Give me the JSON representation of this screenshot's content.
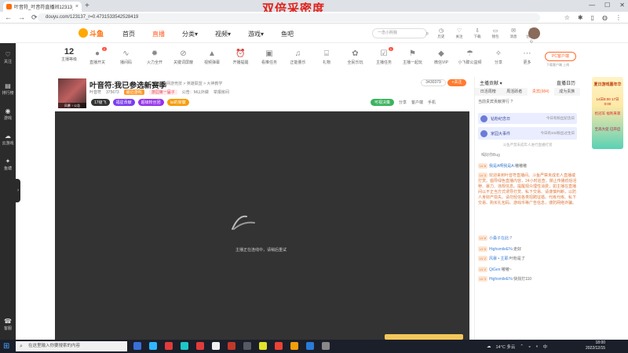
{
  "browser": {
    "tab_title": "叶音符_叶音符直播间12313_斗鱼",
    "tab_close": "×",
    "new_tab": "+",
    "overlay_text": "双倍采密度",
    "url": "douyu.com/123137_r=0.4731533542528419",
    "nav": {
      "back": "←",
      "forward": "→",
      "reload": "⟳"
    },
    "window_controls": {
      "minimize": "—",
      "maximize": "☐",
      "close": "✕"
    }
  },
  "header": {
    "logo_text": "斗鱼",
    "nav": [
      "首页",
      "直播",
      "分类▾",
      "视频▾",
      "游戏▾",
      "鱼吧"
    ],
    "active_nav": "直播",
    "search_placeholder": "一念小熙我",
    "icons": [
      {
        "name": "history",
        "label": "历史",
        "glyph": "◷"
      },
      {
        "name": "follow",
        "label": "关注",
        "glyph": "♡"
      },
      {
        "name": "download",
        "label": "下载",
        "glyph": "⇩"
      },
      {
        "name": "wallet",
        "label": "钱包",
        "glyph": "▭"
      },
      {
        "name": "message",
        "label": "消息",
        "glyph": "✉"
      },
      {
        "name": "creator",
        "label": "创作中心",
        "glyph": "✎"
      }
    ]
  },
  "leftbar": [
    {
      "label": "关注",
      "glyph": "♡"
    },
    {
      "label": "排行榜",
      "glyph": "▤"
    },
    {
      "label": "游戏",
      "glyph": "◉"
    },
    {
      "label": "云游戏",
      "glyph": "☁"
    },
    {
      "label": "鱼塘",
      "glyph": "✦"
    },
    {
      "label": "客服",
      "glyph": "☎"
    }
  ],
  "toolbar": {
    "level_num": "12",
    "level_label": "主播等级",
    "items": [
      {
        "label": "直播开关",
        "glyph": "●",
        "badge": "2"
      },
      {
        "label": "播间码",
        "glyph": "∿",
        "badge": ""
      },
      {
        "label": "火力全开",
        "glyph": "✹",
        "badge": ""
      },
      {
        "label": "关键词屏蔽",
        "glyph": "⊘",
        "badge": ""
      },
      {
        "label": "视频弹幕",
        "glyph": "▲",
        "badge": ""
      },
      {
        "label": "开播提醒",
        "glyph": "⏰",
        "badge": ""
      },
      {
        "label": "看推任务",
        "glyph": "▣",
        "badge": ""
      },
      {
        "label": "正能量乐",
        "glyph": "♫",
        "badge": ""
      },
      {
        "label": "礼物",
        "glyph": "⌸",
        "badge": ""
      },
      {
        "label": "全民乐玩",
        "glyph": "✿",
        "badge": ""
      },
      {
        "label": "主播任务",
        "glyph": "☑",
        "badge": "1"
      },
      {
        "label": "主播一起玩",
        "glyph": "⚑",
        "badge": ""
      },
      {
        "label": "微信VIP",
        "glyph": "◆",
        "badge": ""
      },
      {
        "label": "小飞碟公益频",
        "glyph": "☂",
        "badge": ""
      },
      {
        "label": "分享",
        "glyph": "✧",
        "badge": ""
      },
      {
        "label": "更多",
        "glyph": "⋯",
        "badge": ""
      }
    ],
    "pc_button": "PC客户端",
    "pc_sub": "下载客户端 上线"
  },
  "room": {
    "avatar_caption": "风暴 ↑ 公告",
    "title": "叶音符:我已参选新赛季",
    "tags": [
      "单机",
      "网游竞技 > 英雄联盟 > 大神教学"
    ],
    "streamer": "叶音符",
    "fans": "375673",
    "badge1": "最近游戏",
    "badge2": "游园第一届子",
    "notice": "公告：M以外做",
    "report": "举报房间",
    "level_pill": "17级飞",
    "pills": [
      {
        "text": "福星贡献",
        "color": "#7c3aed"
      },
      {
        "text": "超级粉丝团",
        "color": "#9333ea"
      },
      {
        "text": "lai的家徽",
        "color": "#f59e0b"
      }
    ],
    "follow_count": "3430379",
    "follow_btn": "+关注",
    "actions": {
      "green": "可视决策",
      "share": "分享",
      "client": "客户端",
      "phone": "手机"
    }
  },
  "player": {
    "message": "主播正在连线中，请稍后重试"
  },
  "right_panel": {
    "head_left": "主播贡献 ▾",
    "head_right": "直播日历",
    "tabs": [
      "日活周榜",
      "周活跃者",
      "贵宾(984)",
      "成为贵族"
    ],
    "active_tab": "贵宾(984)",
    "subtitle": "当前贵宾贡献排行 ?",
    "card1_text": "钻粉纪念日",
    "card1_right": "今日有粉丝纪念日",
    "card2_text": "家园大事件",
    "card2_right": "今日有342粉丝过生日",
    "notice": "斗鱼严禁未成年人进行直播打赏",
    "host": "喝好你Bug",
    "chat": [
      {
        "lvl": "LV 8",
        "user": "我是A啊我是A:",
        "text": "嗷嗷嗷",
        "sys": false
      },
      {
        "lvl": "LV 3",
        "user": "",
        "text": "欢迎来到叶音符直播间。斗鱼严禁未成年人直播或打赏。倡导绿色直播内容，24小时巡查。禁止传播低俗淫秽、暴力、违规信息。提醒观众理性消费，如主播在直播间以不正当方式诱导打赏、私下交易、请谨慎判断，以防人身财产损失。请勿轻信各类招聘征婚、代练代练、私下交易、购买礼包码、游戏币等广告信息，谨防网络诈骗。",
        "sys": true
      },
      {
        "lvl": "LV 8",
        "user": "小桑子在此:",
        "text": "？",
        "sys": false
      },
      {
        "lvl": "LV 5",
        "user": "HighsmileE%:",
        "text": "走好",
        "sys": false
      },
      {
        "lvl": "LV 2",
        "user": "风暴 • 主耶:",
        "text": "叶粉是了",
        "sys": false
      },
      {
        "lvl": "LV 2",
        "user": "QiGen:",
        "text": "嗷嗷~",
        "sys": false
      },
      {
        "lvl": "LV 3",
        "user": "HighsmileE%:",
        "text": "快找打110",
        "sys": false
      }
    ]
  },
  "ad": {
    "line1": "夏日游戏嘉年华",
    "line2": "14日8:00 17日0:00",
    "line3": "抢冠军 福利来袭",
    "line4": "至高大促 已开启"
  },
  "taskbar": {
    "search_placeholder": "在这里输入你要搜索的内容",
    "weather": "14°C 多云",
    "ime": "中",
    "time": "18:00",
    "date": "2022/12/15",
    "apps": [
      "#3a6fd8",
      "#2fb6ff",
      "#e23b3b",
      "#1ec7c7",
      "#e23b3b",
      "#f0f0f0",
      "#c0392b",
      "#fff4",
      "#e2e22b",
      "#ea4335",
      "#f59e0b",
      "#2b7bd8",
      "#888"
    ]
  },
  "colors": {
    "accent": "#ff5d23",
    "player_bg": "#333333"
  }
}
